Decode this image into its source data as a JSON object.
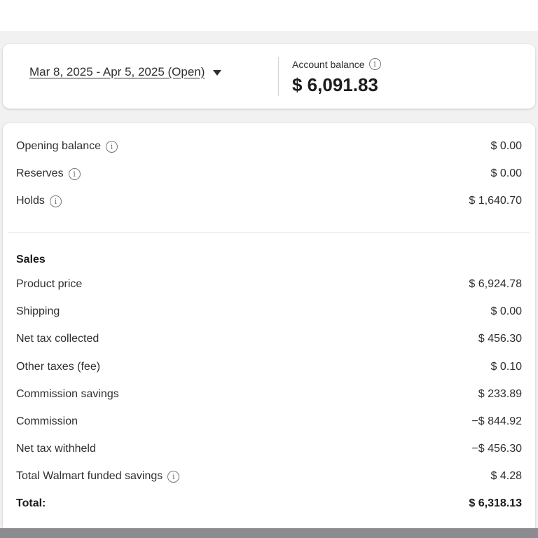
{
  "header": {
    "period_label": "Mar 8, 2025 - Apr 5, 2025 (Open)",
    "balance_label": "Account balance",
    "balance_value": "$ 6,091.83"
  },
  "summary": [
    {
      "label": "Opening balance",
      "value": "$ 0.00",
      "info": true
    },
    {
      "label": "Reserves",
      "value": "$ 0.00",
      "info": true
    },
    {
      "label": "Holds",
      "value": "$ 1,640.70",
      "info": true
    }
  ],
  "sales": {
    "title": "Sales",
    "rows": [
      {
        "label": "Product price",
        "value": "$ 6,924.78"
      },
      {
        "label": "Shipping",
        "value": "$ 0.00"
      },
      {
        "label": "Net tax collected",
        "value": "$ 456.30"
      },
      {
        "label": "Other taxes (fee)",
        "value": "$ 0.10"
      },
      {
        "label": "Commission savings",
        "value": "$ 233.89"
      },
      {
        "label": "Commission",
        "value": "−$ 844.92"
      },
      {
        "label": "Net tax withheld",
        "value": "−$ 456.30"
      },
      {
        "label": "Total Walmart funded savings",
        "value": "$ 4.28"
      }
    ],
    "total_label": "Total:",
    "total_value": "$ 6,318.13"
  },
  "icons": {
    "info": "info-icon",
    "caret": "caret-down-icon"
  },
  "info_glyph": "i"
}
